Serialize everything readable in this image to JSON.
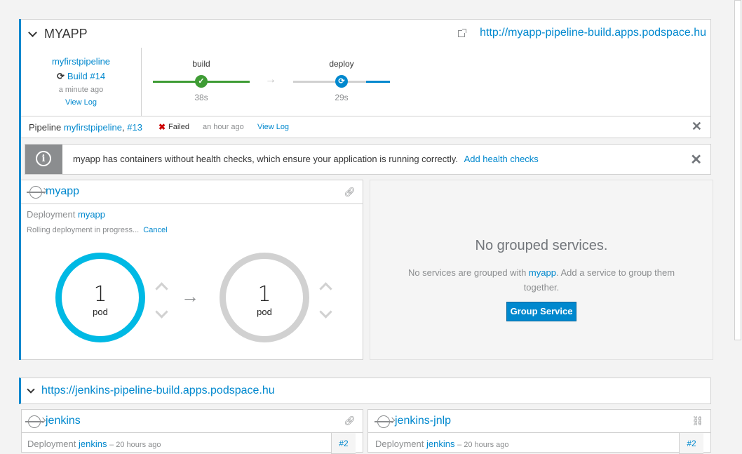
{
  "app": {
    "title": "MYAPP",
    "route_url": "http://myapp-pipeline-build.apps.podspace.hu"
  },
  "pipeline": {
    "name": "myfirstpipeline",
    "build": "Build #14",
    "time_ago": "a minute ago",
    "view_log": "View Log",
    "stages": [
      {
        "name": "build",
        "duration": "38s",
        "status": "success"
      },
      {
        "name": "deploy",
        "duration": "29s",
        "status": "running"
      }
    ]
  },
  "pipeline_history": {
    "prefix": "Pipeline",
    "name": "myfirstpipeline",
    "separator": ",",
    "build": "#13",
    "status": "Failed",
    "time_ago": "an hour ago",
    "view_log": "View Log"
  },
  "alert": {
    "message": "myapp has containers without health checks, which ensure your application is running correctly.",
    "action": "Add health checks"
  },
  "service": {
    "name": "myapp",
    "deployment_label": "Deployment",
    "deployment_name": "myapp",
    "rolling_text": "Rolling deployment in progress...",
    "cancel": "Cancel",
    "old_pods": {
      "count": "1",
      "label": "pod"
    },
    "new_pods": {
      "count": "1",
      "label": "pod"
    }
  },
  "grouped": {
    "title": "No grouped services.",
    "text_before": "No services are grouped with",
    "text_link": "myapp",
    "text_after": ". Add a service to group them together.",
    "button": "Group Service"
  },
  "app2": {
    "route_url": "https://jenkins-pipeline-build.apps.podspace.hu",
    "services": [
      {
        "name": "jenkins",
        "deployment_label": "Deployment",
        "deployment_name": "jenkins",
        "time_ago": "– 20 hours ago",
        "badge": "#2"
      },
      {
        "name": "jenkins-jnlp",
        "deployment_label": "Deployment",
        "deployment_name": "jenkins",
        "time_ago": "– 20 hours ago",
        "badge": "#2"
      }
    ]
  },
  "colors": {
    "accent": "#0088ce",
    "success": "#3f9c35",
    "danger": "#cc0000",
    "pod_active": "#00b9e4",
    "pod_inactive": "#d1d1d1"
  }
}
